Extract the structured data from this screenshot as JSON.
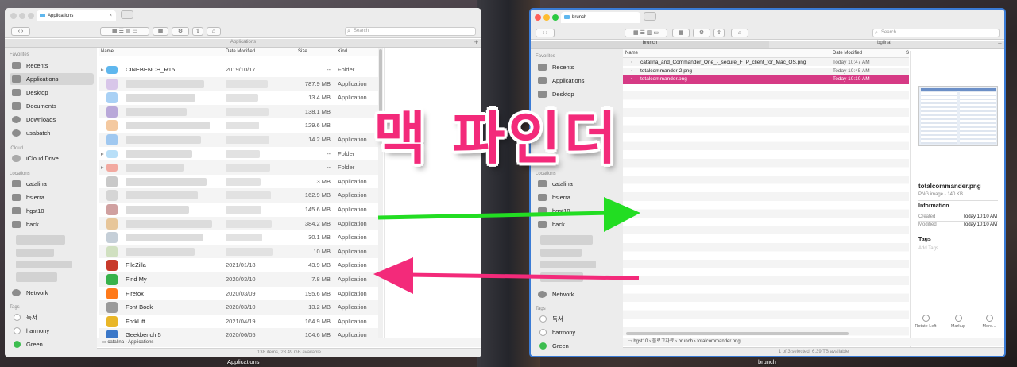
{
  "left_window": {
    "tab_title": "Applications",
    "path_header": "Applications",
    "search_placeholder": "Search",
    "sidebar": {
      "favorites_header": "Favorites",
      "favorites": [
        "Recents",
        "Applications",
        "Desktop",
        "Documents",
        "Downloads",
        "usabatch"
      ],
      "icloud_header": "iCloud",
      "icloud": [
        "iCloud Drive"
      ],
      "locations_header": "Locations",
      "locations": [
        "catalina",
        "hsierra",
        "hgst10",
        "back"
      ],
      "network": "Network",
      "tags_header": "Tags",
      "tags": [
        "독서",
        "harmony",
        "Green"
      ]
    },
    "columns": {
      "name": "Name",
      "date": "Date Modified",
      "size": "Size",
      "kind": "Kind"
    },
    "rows": [
      {
        "name": "CINEBENCH_R15",
        "date": "2019/10/17",
        "size": "--",
        "kind": "Folder"
      },
      {
        "name": "",
        "date": "",
        "size": "787.9 MB",
        "kind": "Application"
      },
      {
        "name": "",
        "date": "",
        "size": "13.4 MB",
        "kind": "Application"
      },
      {
        "name": "",
        "date": "",
        "size": "138.1 MB",
        "kind": ""
      },
      {
        "name": "",
        "date": "",
        "size": "129.6 MB",
        "kind": ""
      },
      {
        "name": "",
        "date": "",
        "size": "14.2 MB",
        "kind": "Application"
      },
      {
        "name": "",
        "date": "",
        "size": "--",
        "kind": "Folder"
      },
      {
        "name": "",
        "date": "",
        "size": "--",
        "kind": "Folder"
      },
      {
        "name": "",
        "date": "",
        "size": "3 MB",
        "kind": "Application"
      },
      {
        "name": "",
        "date": "",
        "size": "162.9 MB",
        "kind": "Application"
      },
      {
        "name": "",
        "date": "",
        "size": "145.6 MB",
        "kind": "Application"
      },
      {
        "name": "",
        "date": "",
        "size": "384.2 MB",
        "kind": "Application"
      },
      {
        "name": "",
        "date": "",
        "size": "30.1 MB",
        "kind": "Application"
      },
      {
        "name": "",
        "date": "",
        "size": "10 MB",
        "kind": "Application"
      },
      {
        "name": "FileZilla",
        "date": "2021/01/18",
        "size": "43.9 MB",
        "kind": "Application"
      },
      {
        "name": "Find My",
        "date": "2020/03/10",
        "size": "7.8 MB",
        "kind": "Application"
      },
      {
        "name": "Firefox",
        "date": "2020/03/09",
        "size": "195.6 MB",
        "kind": "Application"
      },
      {
        "name": "Font Book",
        "date": "2020/03/10",
        "size": "13.2 MB",
        "kind": "Application"
      },
      {
        "name": "ForkLift",
        "date": "2021/04/19",
        "size": "164.9 MB",
        "kind": "Application"
      },
      {
        "name": "Geekbench 5",
        "date": "2020/06/05",
        "size": "104.6 MB",
        "kind": "Application"
      }
    ],
    "breadcrumb": [
      "catalina",
      "Applications"
    ],
    "status": "138 items, 28.49 GB available",
    "window_label": "Applications"
  },
  "right_window": {
    "tab_title": "brunch",
    "search_placeholder": "Search",
    "path_tabs": [
      "brunch",
      "bgfinal"
    ],
    "sidebar": {
      "favorites_header": "Favorites",
      "favorites": [
        "Recents",
        "Applications",
        "Desktop"
      ],
      "locations_header": "Locations",
      "locations": [
        "catalina",
        "hsierra",
        "hgst10",
        "back"
      ],
      "network": "Network",
      "tags_header": "Tags",
      "tags": [
        "독서",
        "harmony",
        "Green"
      ]
    },
    "columns": {
      "name": "Name",
      "date": "Date Modified",
      "size": "S"
    },
    "rows": [
      {
        "name": "catalina_and_Commander_One_-_secure_FTP_client_for_Mac_OS.png",
        "date": "Today 10:47 AM"
      },
      {
        "name": "totalcommander-2.png",
        "date": "Today 10:45 AM"
      },
      {
        "name": "totalcommander.png",
        "date": "Today 10:10 AM",
        "selected": true
      }
    ],
    "preview": {
      "title": "totalcommander.png",
      "subtitle": "PNG image - 140 KB",
      "info_header": "Information",
      "created_label": "Created",
      "created_value": "Today 10:10 AM",
      "modified_label": "Modified",
      "modified_value": "Today 10:10 AM",
      "tags_header": "Tags",
      "tags_placeholder": "Add Tags...",
      "actions": [
        "Rotate Left",
        "Markup",
        "More..."
      ]
    },
    "breadcrumb": [
      "hgst10",
      "블로그자료",
      "brunch",
      "totalcommander.png"
    ],
    "status": "1 of 3 selected, 6.39 TB available",
    "window_label": "brunch"
  },
  "overlay_text": "맥 파인더",
  "colors": {
    "accent": "#d63a85",
    "overlay": "#f32a7a",
    "arrow_green": "#22dd22",
    "arrow_pink": "#f32a7a"
  }
}
